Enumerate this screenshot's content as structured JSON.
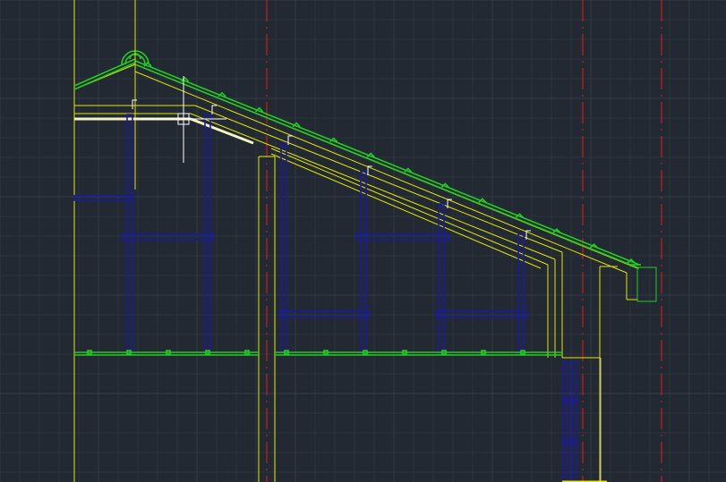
{
  "drawing": {
    "type": "cad-roof-section",
    "background_color": "#222933",
    "grid_minor_color": "#2a323d",
    "grid_major_color": "#333c48",
    "colors": {
      "wall_lines": "#e6e600",
      "rafter_lines": "#e6e600",
      "roof_tiles": "#22cc22",
      "timber_frame": "#1a1aa8",
      "axis_lines": "#c81e1e",
      "cursor": "#ffffff",
      "highlight": "#f4f4c0",
      "guide_line": "#b8b8b8"
    },
    "icons": {
      "crosshair": "crosshair-cursor-icon",
      "ridge_cap": "ridge-tile-icon",
      "gutter": "gutter-icon",
      "connector": "bracket-icon"
    }
  }
}
